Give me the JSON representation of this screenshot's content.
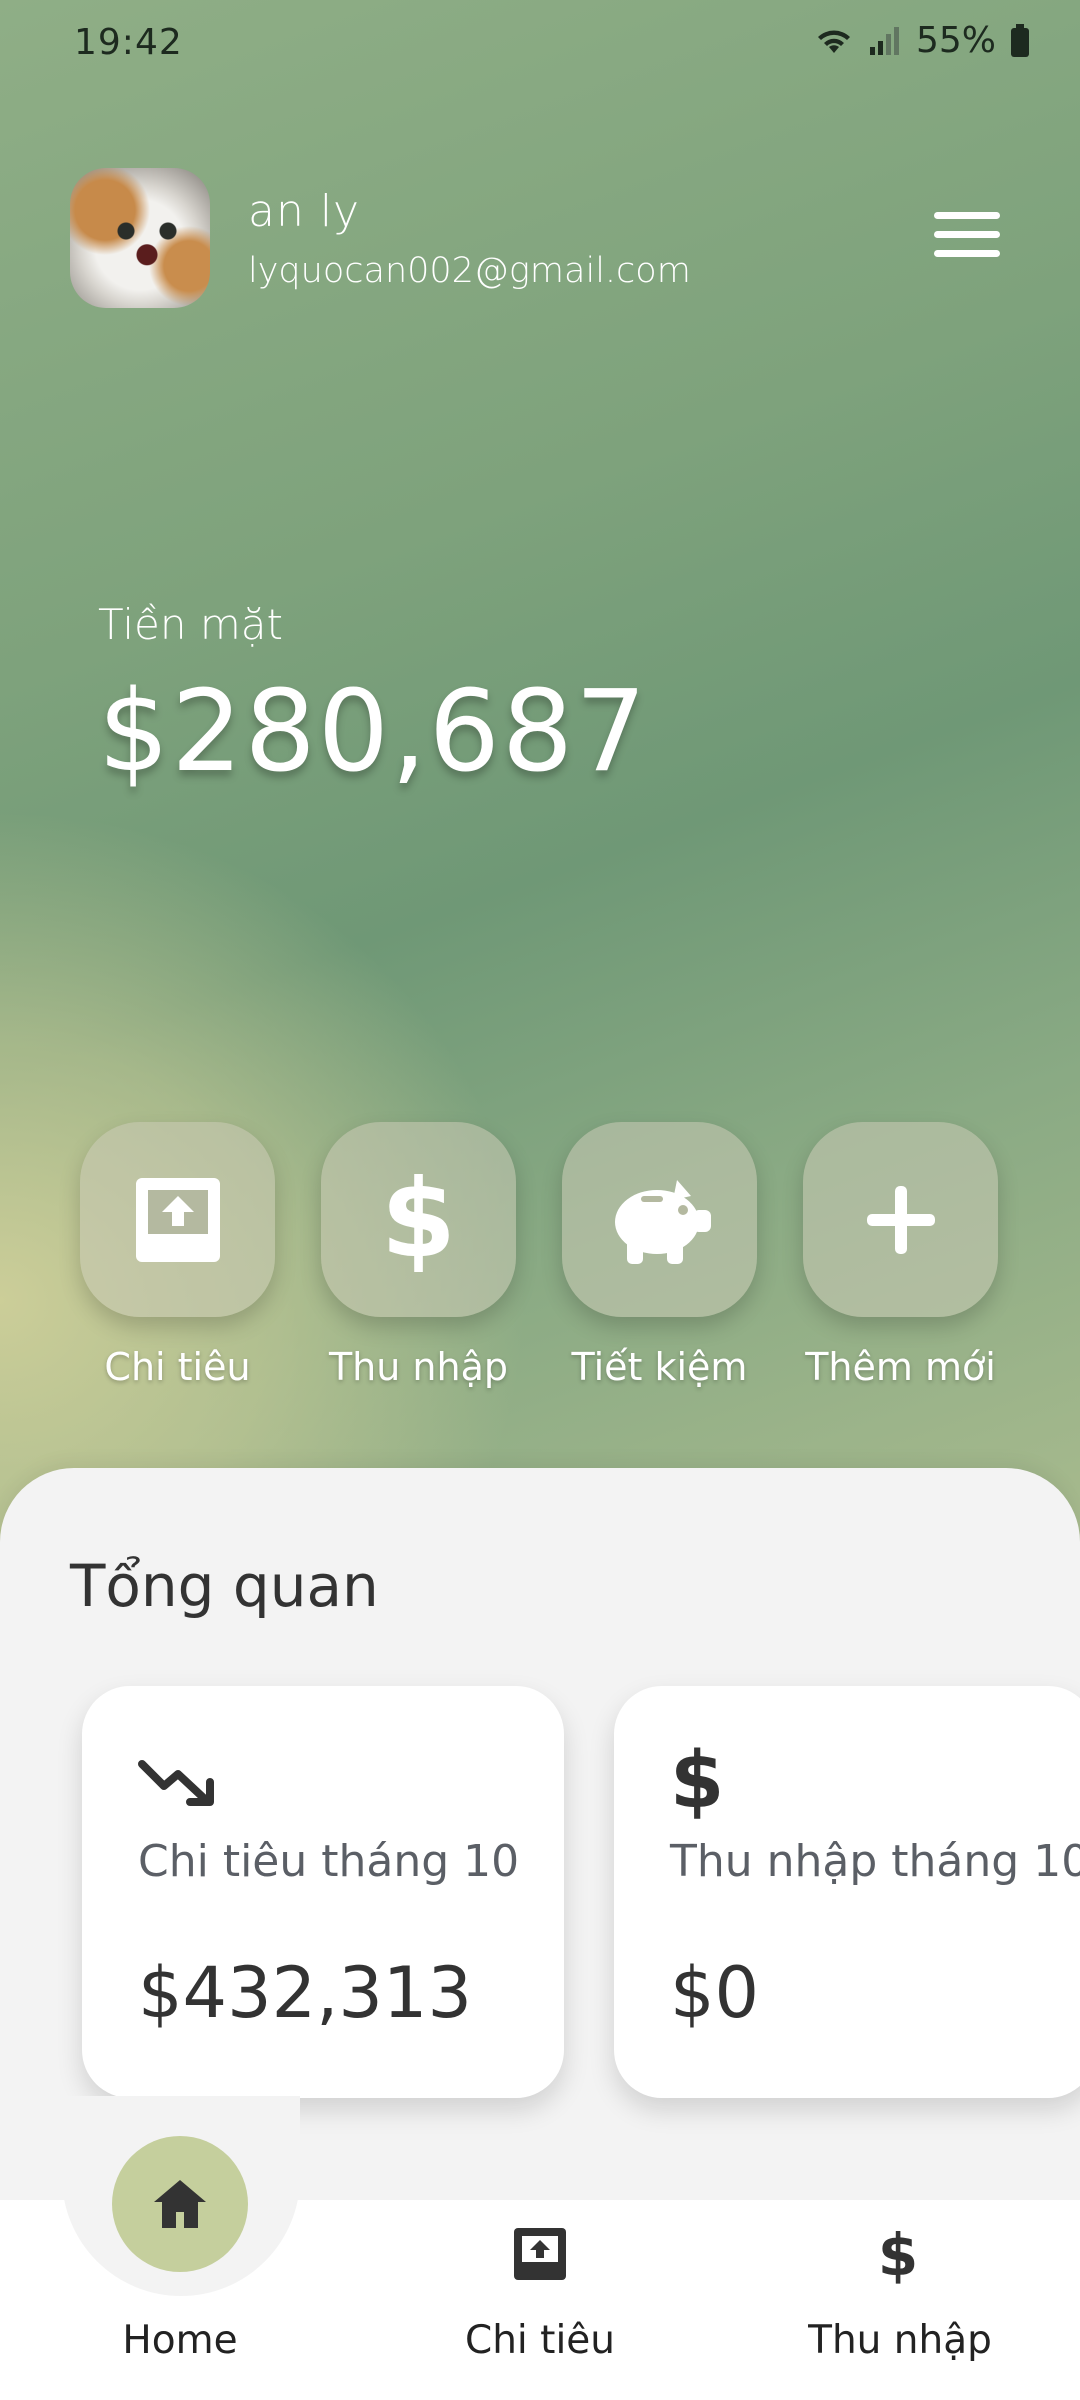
{
  "status_bar": {
    "time": "19:42",
    "battery": "55%"
  },
  "profile": {
    "name": "an ly",
    "email": "lyquocan002@gmail.com"
  },
  "balance": {
    "label": "Tiền mặt",
    "value": "$280,687"
  },
  "actions": [
    {
      "label": "Chi tiêu",
      "icon": "expense-upload-icon"
    },
    {
      "label": "Thu nhập",
      "icon": "dollar-icon"
    },
    {
      "label": "Tiết kiệm",
      "icon": "piggy-bank-icon"
    },
    {
      "label": "Thêm mới",
      "icon": "plus-icon"
    }
  ],
  "overview": {
    "title": "Tổng quan",
    "cards": [
      {
        "title": "Chi tiêu tháng 10",
        "amount": "$432,313",
        "icon": "trending-down-icon"
      },
      {
        "title": "Thu nhập tháng 10",
        "amount": "$0",
        "icon": "dollar-icon"
      }
    ]
  },
  "bottom_nav": [
    {
      "label": "Home",
      "icon": "home-icon",
      "active": true
    },
    {
      "label": "Chi tiêu",
      "icon": "expense-upload-icon"
    },
    {
      "label": "Thu nhập",
      "icon": "dollar-icon"
    }
  ],
  "colors": {
    "accent": "#c5cf9d",
    "header_green": "#6f9876",
    "header_yellow": "#d0d09a"
  }
}
